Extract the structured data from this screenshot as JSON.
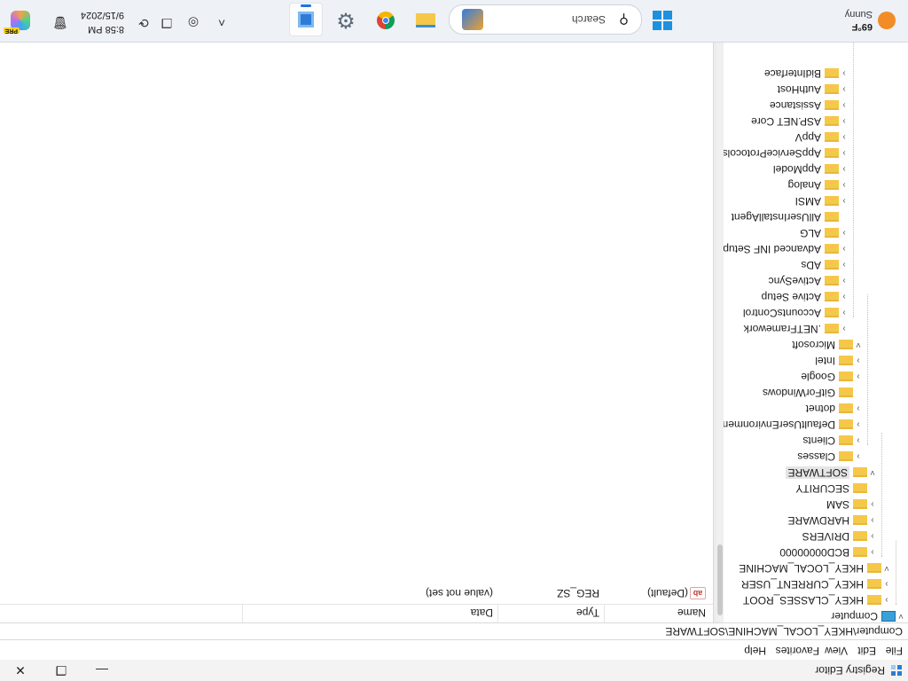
{
  "window": {
    "title": "Registry Editor",
    "minimize": "—",
    "maximize": "❐",
    "close": "✕"
  },
  "menu": [
    "File",
    "Edit",
    "View",
    "Favorites",
    "Help"
  ],
  "address": "Computer\\HKEY_LOCAL_MACHINE\\SOFTWARE",
  "tree": {
    "root": "Computer",
    "hives": [
      "HKEY_CLASSES_ROOT",
      "HKEY_CURRENT_USER",
      "HKEY_LOCAL_MACHINE"
    ],
    "hklm_keys": [
      "BCD00000000",
      "DRIVERS",
      "HARDWARE",
      "SAM",
      "SECURITY",
      "SOFTWARE"
    ],
    "software_keys": [
      "Classes",
      "Clients",
      "DefaultUserEnvironment",
      "dotnet",
      "GitForWindows",
      "Google",
      "Intel",
      "Microsoft"
    ],
    "microsoft_keys": [
      ".NETFramework",
      "AccountsControl",
      "Active Setup",
      "ActiveSync",
      "ADs",
      "Advanced INF Setup",
      "ALG",
      "AllUserInstallAgent",
      "AMSI",
      "Analog",
      "AppModel",
      "AppServiceProtocols",
      "AppV",
      "ASP.NET Core",
      "Assistance",
      "AuthHost",
      "BidInterface"
    ]
  },
  "values": {
    "columns": [
      "Name",
      "Type",
      "Data"
    ],
    "rows": [
      {
        "name": "(Default)",
        "type": "REG_SZ",
        "data": "(value not set)"
      }
    ],
    "value_icon": "ab"
  },
  "taskbar": {
    "weather_temp": "69°F",
    "weather_condition": "Sunny",
    "search_placeholder": "Search",
    "clock_time": "8:58 PM",
    "clock_date": "9/15/2024",
    "copilot_badge": "PRE"
  },
  "colors": {
    "folder": "#f5c84a",
    "selection": "#e5e5e5",
    "taskbar": "#eef1f6",
    "accent": "#1e90e0"
  },
  "icons": [
    "registry-editor-icon",
    "folder-icon",
    "computer-icon",
    "string-value-icon",
    "windows-start-icon",
    "search-icon",
    "chrome-icon",
    "settings-gear-icon",
    "file-explorer-icon",
    "regedit-icon",
    "chevron-up-icon",
    "eye-slash-icon",
    "copy-icon",
    "sync-icon",
    "trash-icon",
    "copilot-icon",
    "weather-sun-icon",
    "hand-cursor-icon"
  ]
}
